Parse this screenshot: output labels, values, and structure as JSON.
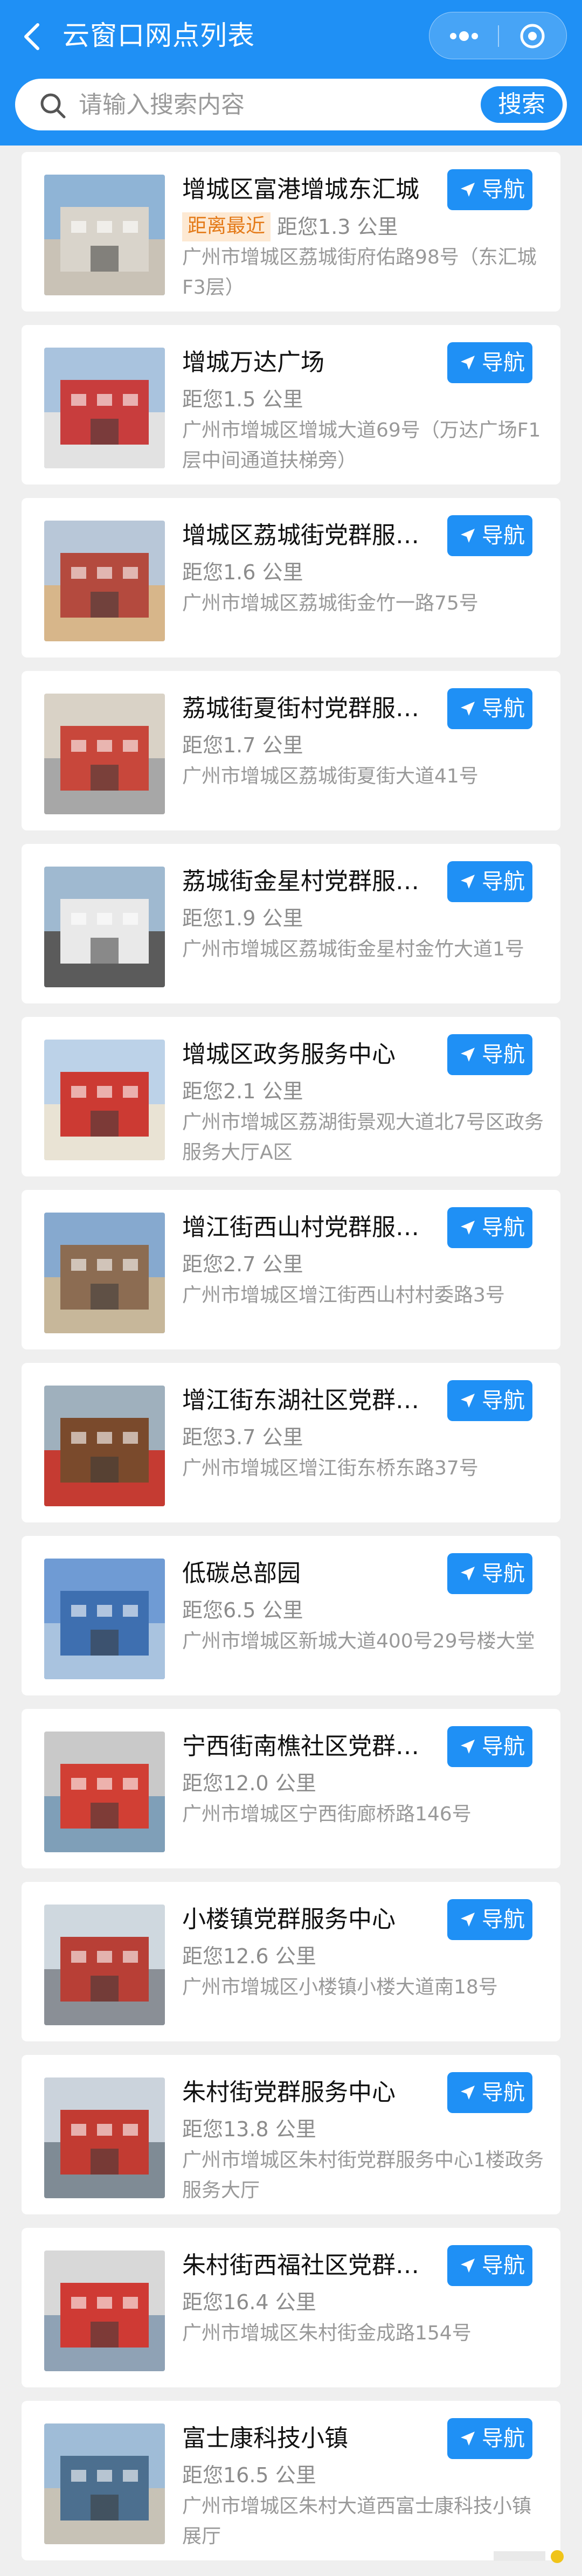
{
  "header": {
    "title": "云窗口网点列表"
  },
  "search": {
    "placeholder": "请输入搜索内容",
    "button_label": "搜索"
  },
  "nav_label": "导航",
  "colors": {
    "primary": "#1f90f5",
    "badge_bg": "#fde9d3",
    "badge_text": "#e47a18"
  },
  "sites": [
    {
      "name": "增城区富港增城东汇城",
      "badge": "距离最近",
      "distance": "距您1.3 公里",
      "address": "广州市增城区荔城街府佑路98号（东汇城F3层）"
    },
    {
      "name": "增城万达广场",
      "badge": "",
      "distance": "距您1.5 公里",
      "address": "广州市增城区增城大道69号（万达广场F1层中间通道扶梯旁）"
    },
    {
      "name": "增城区荔城街党群服…",
      "badge": "",
      "distance": "距您1.6 公里",
      "address": "广州市增城区荔城街金竹一路75号"
    },
    {
      "name": "荔城街夏街村党群服…",
      "badge": "",
      "distance": "距您1.7 公里",
      "address": "广州市增城区荔城街夏街大道41号"
    },
    {
      "name": "荔城街金星村党群服…",
      "badge": "",
      "distance": "距您1.9 公里",
      "address": "广州市增城区荔城街金星村金竹大道1号"
    },
    {
      "name": "增城区政务服务中心",
      "badge": "",
      "distance": "距您2.1 公里",
      "address": "广州市增城区荔湖街景观大道北7号区政务服务大厅A区"
    },
    {
      "name": "增江街西山村党群服…",
      "badge": "",
      "distance": "距您2.7 公里",
      "address": "广州市增城区增江街西山村村委路3号"
    },
    {
      "name": "增江街东湖社区党群…",
      "badge": "",
      "distance": "距您3.7 公里",
      "address": "广州市增城区增江街东桥东路37号"
    },
    {
      "name": "低碳总部园",
      "badge": "",
      "distance": "距您6.5 公里",
      "address": "广州市增城区新城大道400号29号楼大堂"
    },
    {
      "name": "宁西街南樵社区党群…",
      "badge": "",
      "distance": "距您12.0 公里",
      "address": "广州市增城区宁西街廊桥路146号"
    },
    {
      "name": "小楼镇党群服务中心",
      "badge": "",
      "distance": "距您12.6 公里",
      "address": "广州市增城区小楼镇小楼大道南18号"
    },
    {
      "name": "朱村街党群服务中心",
      "badge": "",
      "distance": "距您13.8 公里",
      "address": "广州市增城区朱村街党群服务中心1楼政务服务大厅"
    },
    {
      "name": "朱村街西福社区党群…",
      "badge": "",
      "distance": "距您16.4 公里",
      "address": "广州市增城区朱村街金成路154号"
    },
    {
      "name": "富士康科技小镇",
      "badge": "",
      "distance": "距您16.5 公里",
      "address": "广州市增城区朱村大道西富士康科技小镇展厅"
    }
  ]
}
